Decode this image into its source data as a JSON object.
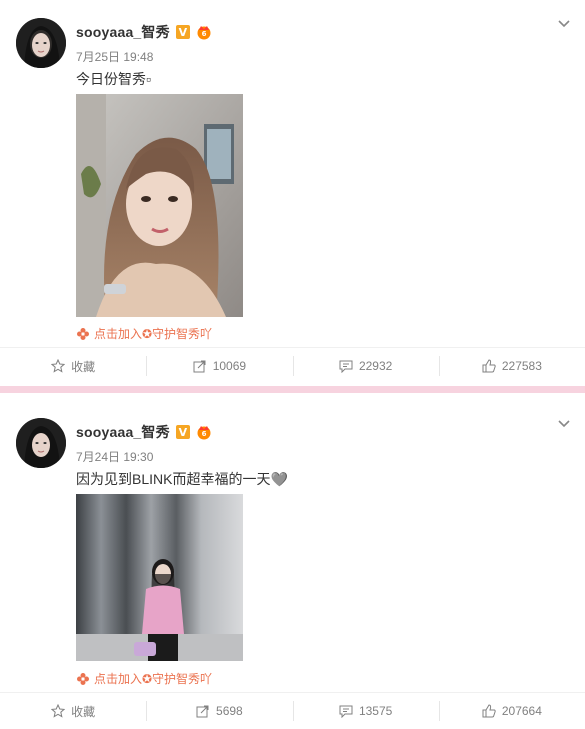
{
  "colors": {
    "accent": "#eb7350",
    "verified": "#f6a623",
    "separator": "#f7d3df",
    "meta_text": "#808080"
  },
  "posts": [
    {
      "username": "sooyaaa_智秀",
      "time": "7月25日 19:48",
      "text": "今日份智秀▫",
      "supertopic": "点击加入✪守护智秀吖",
      "actions": {
        "favorite_label": "收藏",
        "repost_count": "10069",
        "comment_count": "22932",
        "like_count": "227583"
      }
    },
    {
      "username": "sooyaaa_智秀",
      "time": "7月24日 19:30",
      "text": "因为见到BLINK而超幸福的一天🩶",
      "supertopic": "点击加入✪守护智秀吖",
      "actions": {
        "favorite_label": "收藏",
        "repost_count": "5698",
        "comment_count": "13575",
        "like_count": "207664"
      }
    }
  ],
  "icons": {
    "verified": "verified-v-icon",
    "vip": "vip-crown-icon",
    "menu": "chevron-down-icon",
    "favorite": "star-icon",
    "repost": "repost-icon",
    "comment": "comment-icon",
    "like": "thumbs-up-icon",
    "supertopic": "flower-icon"
  }
}
